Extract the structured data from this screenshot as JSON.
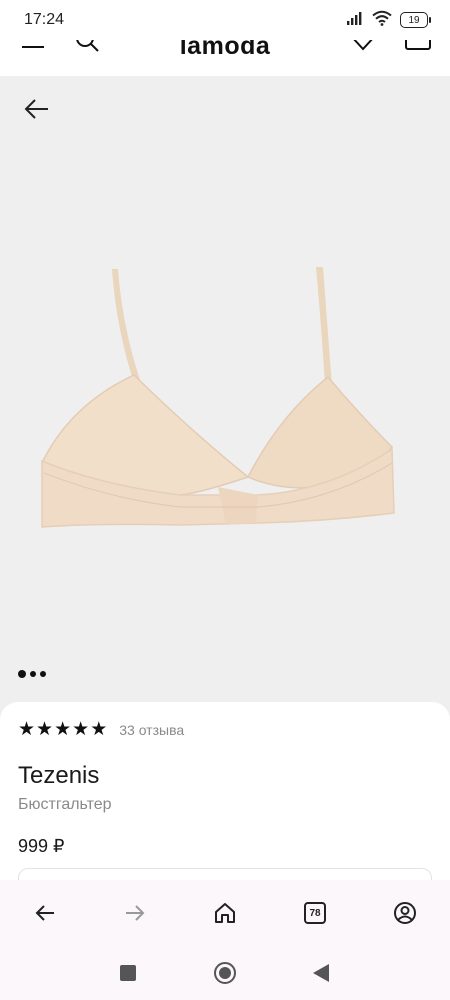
{
  "status_bar": {
    "time": "17:24",
    "battery": "19",
    "icons": [
      "signal-icon",
      "wifi-icon",
      "battery-icon"
    ]
  },
  "app_header": {
    "logo": "lamoda",
    "icons": [
      "menu-icon",
      "search-icon",
      "heart-icon",
      "cart-icon"
    ]
  },
  "gallery": {
    "image_count": 3,
    "active_index": 0
  },
  "product": {
    "rating_stars": 5,
    "reviews": "33 отзыва",
    "brand": "Tezenis",
    "type": "Бюстгальтер",
    "price": "999 ₽"
  },
  "browser_nav": {
    "tabs_count": "78",
    "icons": [
      "back-icon",
      "forward-icon",
      "home-icon",
      "tabs-icon",
      "account-icon"
    ]
  },
  "system_nav": {
    "icons": [
      "recents-icon",
      "home-circle-icon",
      "back-triangle-icon"
    ]
  },
  "colors": {
    "gallery_bg": "#efeff0",
    "product_beige": "#f0dcc6",
    "promo_green": "#4cbb5a"
  }
}
